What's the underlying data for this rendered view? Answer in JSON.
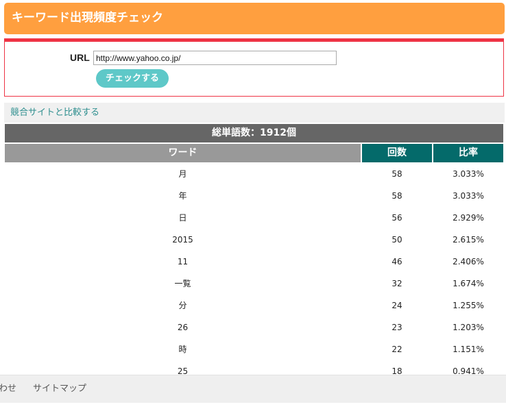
{
  "header": {
    "title": "キーワード出現頻度チェック"
  },
  "form": {
    "url_label": "URL",
    "url_value": "http://www.yahoo.co.jp/",
    "submit_label": "チェックする"
  },
  "compare": {
    "link_label": "競合サイトと比較する"
  },
  "results": {
    "total_label": "総単語数：1912個",
    "columns": {
      "word": "ワード",
      "count": "回数",
      "ratio": "比率"
    },
    "rows": [
      {
        "word": "月",
        "count": "58",
        "ratio": "3.033%"
      },
      {
        "word": "年",
        "count": "58",
        "ratio": "3.033%"
      },
      {
        "word": "日",
        "count": "56",
        "ratio": "2.929%"
      },
      {
        "word": "2015",
        "count": "50",
        "ratio": "2.615%"
      },
      {
        "word": "11",
        "count": "46",
        "ratio": "2.406%"
      },
      {
        "word": "一覧",
        "count": "32",
        "ratio": "1.674%"
      },
      {
        "word": "分",
        "count": "24",
        "ratio": "1.255%"
      },
      {
        "word": "26",
        "count": "23",
        "ratio": "1.203%"
      },
      {
        "word": "時",
        "count": "22",
        "ratio": "1.151%"
      },
      {
        "word": "25",
        "count": "18",
        "ratio": "0.941%"
      }
    ]
  },
  "footer": {
    "contact_label": "わせ",
    "sitemap_label": "サイトマップ"
  },
  "colors": {
    "header_orange": "#ff9f3f",
    "form_border_red": "#ee3344",
    "button_teal": "#5ec8c8",
    "link_teal": "#2f8f8f",
    "column_header_teal": "#046a6a",
    "total_bar_gray": "#666666",
    "word_header_gray": "#999999"
  }
}
